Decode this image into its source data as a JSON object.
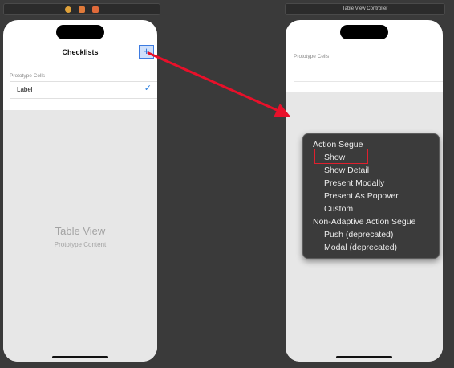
{
  "left_scene": {
    "nav_title": "Checklists",
    "add_button_label": "+",
    "section_header": "Prototype Cells",
    "cell_label": "Label",
    "checkmark": "✓",
    "table_view_title": "Table View",
    "table_view_subtitle": "Prototype Content"
  },
  "right_scene": {
    "scene_title": "Table View Controller",
    "section_header": "Prototype Cells"
  },
  "segue_menu": {
    "sections": [
      {
        "header": "Action Segue",
        "items": [
          "Show",
          "Show Detail",
          "Present Modally",
          "Present As Popover",
          "Custom"
        ]
      },
      {
        "header": "Non-Adaptive Action Segue",
        "items": [
          "Push (deprecated)",
          "Modal (deprecated)"
        ]
      }
    ],
    "highlighted_item": "Show"
  },
  "colors": {
    "canvas": "#3a3a3a",
    "arrow": "#e8102a",
    "highlight_box": "#e0202e",
    "checkmark": "#2a7fe0"
  }
}
